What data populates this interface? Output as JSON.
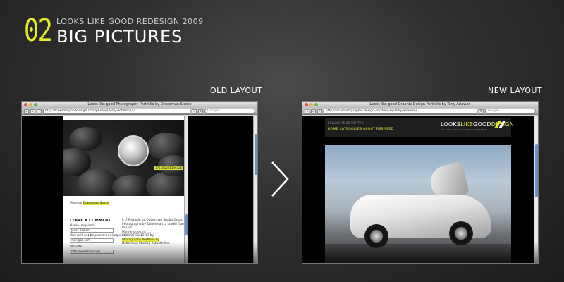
{
  "header": {
    "number": "02",
    "subtitle": "LOOKS LIKE GOOD REDESIGN 2009",
    "title": "BIG PICTURES"
  },
  "labels": {
    "old": "OLD LAYOUT",
    "new": "NEW LAYOUT"
  },
  "old_window": {
    "title": "Looks like good Photography Portfolio by Doberman Studio",
    "url": "http://lookslikegooddesign.com/photography-doberman/",
    "search_placeholder": "Google",
    "photo_tag": "175151201196026",
    "more_on_prefix": "More on",
    "more_on_link": "Doberman Studio",
    "leave_comment": "LEAVE A COMMENT",
    "name_label": "Name (required)",
    "name_value": "Jonas Kiehler",
    "mail_label": "Mail (will not be published) (required)",
    "mail_value": "mail@kk.com",
    "website_label": "Website",
    "website_value": "http://www.blue.com",
    "pingback_1": "[...] Portfolio by Doberman Studio Great",
    "pingback_2": "Photography by Doberman, a studio from Russia.",
    "pingback_3": "More inside this [...]",
    "pingback_4": "2008/07/28 10:17 by",
    "pingback_link": "Photography Portfolio by",
    "pingback_5": "Doberman Studio | KotaxOnline"
  },
  "new_window": {
    "title": "Looks like good Graphic Design Portfolio by Tony Ariawan",
    "url": "http://localhost/graphic-design-portfolio-by-tony-ariawan/",
    "search_placeholder": "Google",
    "follow": "FOLLOW ME ON TWITTER",
    "menu": "HOME   CATEGORIES   ABOUT   RSS FEED",
    "logo_a": "LOOKS",
    "logo_b": "LIKE",
    "logo_c": "GOOD",
    "logo_d": "DESIGN",
    "tagline": "FUCKING HIGH QUALITY INSPIRATION"
  },
  "colors": {
    "accent": "#e4e83a",
    "background": "#2e2e2e"
  }
}
